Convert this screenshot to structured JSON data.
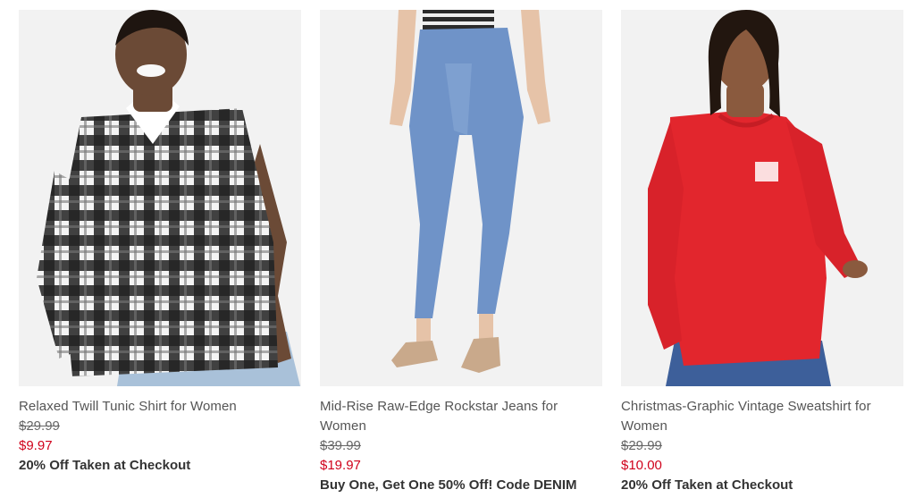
{
  "products": [
    {
      "name": "Relaxed Twill Tunic Shirt for Women",
      "was_price": "$29.99",
      "sale_price": "$9.97",
      "promo": "20% Off Taken at Checkout"
    },
    {
      "name": "Mid-Rise Raw-Edge Rockstar Jeans for Women",
      "was_price": "$39.99",
      "sale_price": "$19.97",
      "promo": "Buy One, Get One 50% Off! Code DENIM"
    },
    {
      "name": "Christmas-Graphic Vintage Sweatshirt for Women",
      "was_price": "$29.99",
      "sale_price": "$10.00",
      "promo": "20% Off Taken at Checkout"
    }
  ],
  "colors": {
    "sale_price": "#d0021b",
    "product_name": "#555555",
    "photo_background": "#f2f2f2"
  }
}
